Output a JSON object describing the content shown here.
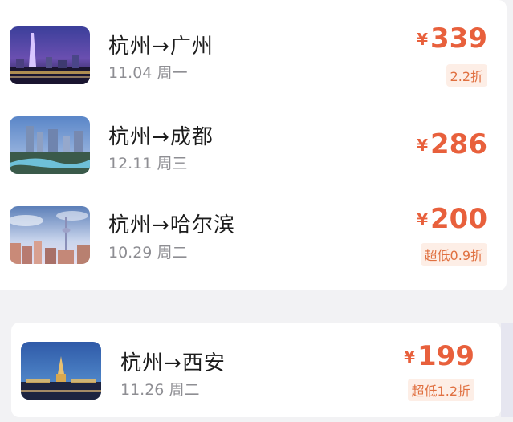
{
  "trips": [
    {
      "from": "杭州",
      "arrow": "→",
      "to": "广州",
      "date": "11.04",
      "weekday": "周一",
      "currency": "¥",
      "price": "339",
      "discount": "2.2折",
      "image": "guangzhou-tower-night"
    },
    {
      "from": "杭州",
      "arrow": "→",
      "to": "成都",
      "date": "12.11",
      "weekday": "周三",
      "currency": "¥",
      "price": "286",
      "discount": "",
      "image": "chengdu-river-city"
    },
    {
      "from": "杭州",
      "arrow": "→",
      "to": "哈尔滨",
      "date": "10.29",
      "weekday": "周二",
      "currency": "¥",
      "price": "200",
      "discount": "超低0.9折",
      "image": "harbin-tv-tower"
    },
    {
      "from": "杭州",
      "arrow": "→",
      "to": "西安",
      "date": "11.26",
      "weekday": "周二",
      "currency": "¥",
      "price": "199",
      "discount": "超低1.2折",
      "image": "xian-pagoda-night"
    }
  ],
  "colors": {
    "price": "#e8603c",
    "badge_bg": "#fdeee6",
    "badge_text": "#e07040"
  }
}
